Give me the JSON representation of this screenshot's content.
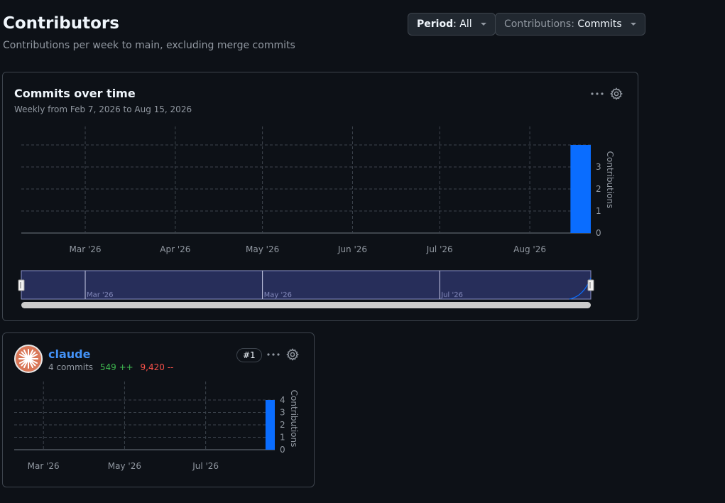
{
  "header": {
    "title": "Contributors",
    "subtitle": "Contributions per week to main, excluding merge commits"
  },
  "filters": {
    "period": {
      "label": "Period",
      "value": "All"
    },
    "contributions": {
      "label": "Contributions",
      "value": "Commits"
    }
  },
  "main_chart": {
    "title": "Commits over time",
    "subtitle": "Weekly from Feb 7, 2026 to Aug 15, 2026"
  },
  "contributor": {
    "name": "claude",
    "commits": "4 commits",
    "additions": "549 ++",
    "deletions": "9,420 --",
    "rank": "#1"
  },
  "colors": {
    "bar": "#0a6dff",
    "grid": "#3d444d",
    "navigator_fill": "#272e5a",
    "navigator_border": "#8b93c9"
  },
  "chart_data": [
    {
      "type": "bar",
      "title": "Commits over time",
      "ylabel": "Contributions",
      "x_ticks": [
        "Mar '26",
        "Apr '26",
        "May '26",
        "Jun '26",
        "Jul '26",
        "Aug '26"
      ],
      "y_ticks": [
        "0",
        "1",
        "2",
        "3"
      ],
      "ylim": [
        0,
        4
      ],
      "x_range": [
        "2026-02-07",
        "2026-08-15"
      ],
      "series": [
        {
          "x": [
            "2026-08-15"
          ],
          "values": [
            4
          ]
        }
      ],
      "navigator_ticks": [
        "Mar '26",
        "May '26",
        "Jul '26"
      ],
      "grid": true
    },
    {
      "type": "bar",
      "title": "claude",
      "ylabel": "Contributions",
      "x_ticks": [
        "Mar '26",
        "May '26",
        "Jul '26"
      ],
      "y_ticks": [
        "0",
        "1",
        "2",
        "3",
        "4"
      ],
      "ylim": [
        0,
        4
      ],
      "x_range": [
        "2026-02-07",
        "2026-08-15"
      ],
      "series": [
        {
          "x": [
            "2026-08-15"
          ],
          "values": [
            4
          ]
        }
      ],
      "grid": true
    }
  ]
}
